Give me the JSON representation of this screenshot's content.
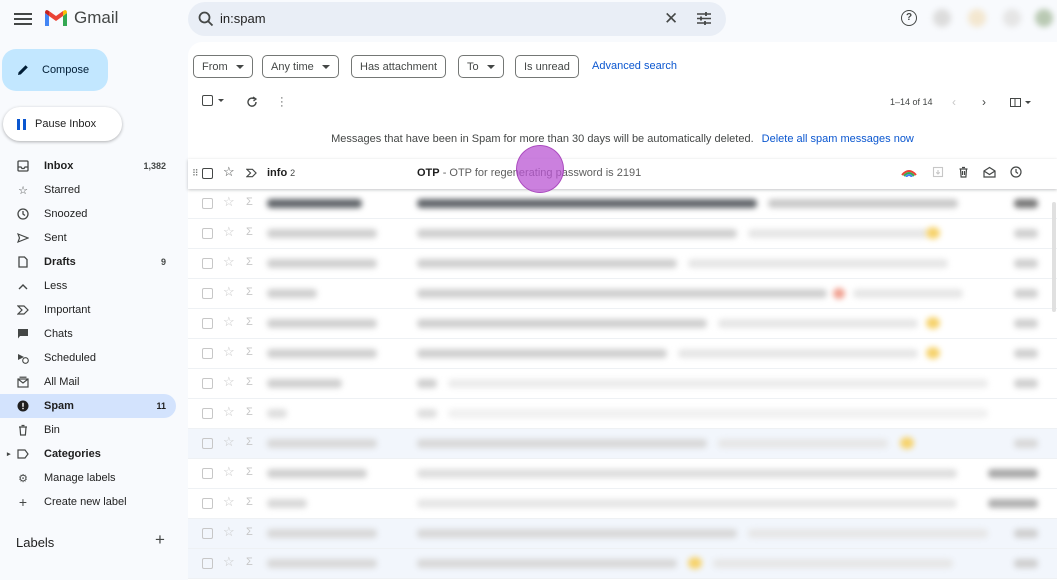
{
  "header": {
    "app_name": "Gmail",
    "search_value": "in:spam",
    "icons": [
      "menu-icon",
      "gmail-logo",
      "search-icon",
      "close-icon",
      "tune-icon",
      "help-icon"
    ]
  },
  "sidebar": {
    "compose_label": "Compose",
    "pause_label": "Pause Inbox",
    "items": [
      {
        "label": "Inbox",
        "count": "1,382",
        "icon": "inbox-icon"
      },
      {
        "label": "Starred",
        "count": "",
        "icon": "star-icon"
      },
      {
        "label": "Snoozed",
        "count": "",
        "icon": "clock-icon"
      },
      {
        "label": "Sent",
        "count": "",
        "icon": "send-icon"
      },
      {
        "label": "Drafts",
        "count": "9",
        "icon": "draft-icon"
      },
      {
        "label": "Less",
        "count": "",
        "icon": "chevron-up-icon"
      },
      {
        "label": "Important",
        "count": "",
        "icon": "important-icon"
      },
      {
        "label": "Chats",
        "count": "",
        "icon": "chat-icon"
      },
      {
        "label": "Scheduled",
        "count": "",
        "icon": "scheduled-icon"
      },
      {
        "label": "All Mail",
        "count": "",
        "icon": "all-mail-icon"
      },
      {
        "label": "Spam",
        "count": "11",
        "icon": "spam-icon"
      },
      {
        "label": "Bin",
        "count": "",
        "icon": "bin-icon"
      },
      {
        "label": "Categories",
        "count": "",
        "icon": "label-icon"
      },
      {
        "label": "Manage labels",
        "count": "",
        "icon": "settings-icon"
      },
      {
        "label": "Create new label",
        "count": "",
        "icon": "plus-icon"
      }
    ],
    "labels_heading": "Labels"
  },
  "filters": {
    "from": "From",
    "any_time": "Any time",
    "has_attachment": "Has attachment",
    "to": "To",
    "is_unread": "Is unread",
    "advanced": "Advanced search"
  },
  "toolbar": {
    "pagination": "1–14 of 14"
  },
  "notice": {
    "text": "Messages that have been in Spam for more than 30 days will be automatically deleted.",
    "link": "Delete all spam messages now"
  },
  "first_email": {
    "sender": "info",
    "count": "2",
    "subject": "OTP",
    "snippet": "- OTP for regenerating password is 2191"
  },
  "colors": {
    "accent": "#0b57d0",
    "active_nav": "#d3e3fd",
    "compose": "#c2e7ff"
  }
}
